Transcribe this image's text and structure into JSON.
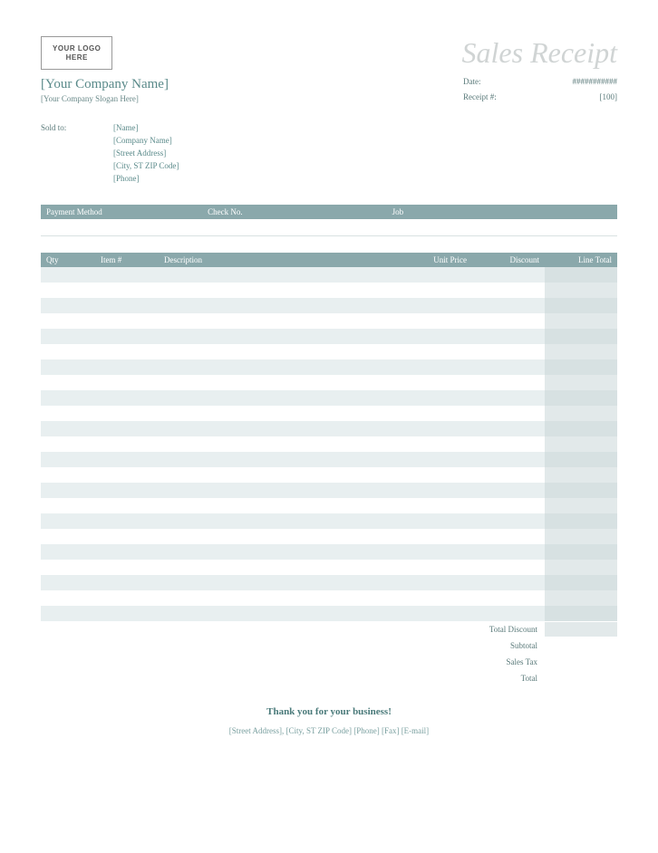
{
  "header": {
    "logo_text": "YOUR LOGO\nHERE",
    "title": "Sales Receipt"
  },
  "company": {
    "name": "[Your Company Name]",
    "slogan": "[Your Company Slogan Here]"
  },
  "meta": {
    "date_label": "Date:",
    "date_value": "###########",
    "receipt_label": "Receipt #:",
    "receipt_value": "[100]"
  },
  "sold_to": {
    "label": "Sold to:",
    "name": "[Name]",
    "company": "[Company Name]",
    "street": "[Street Address]",
    "city": "[City, ST  ZIP Code]",
    "phone": "[Phone]"
  },
  "payment_headers": {
    "method": "Payment Method",
    "check": "Check No.",
    "job": "Job"
  },
  "items_headers": {
    "qty": "Qty",
    "item": "Item #",
    "description": "Description",
    "unit_price": "Unit Price",
    "discount": "Discount",
    "line_total": "Line Total"
  },
  "items_row_count": 23,
  "totals": {
    "total_discount_label": "Total Discount",
    "subtotal_label": "Subtotal",
    "sales_tax_label": "Sales Tax",
    "total_label": "Total",
    "total_discount_value": "",
    "subtotal_value": "",
    "sales_tax_value": "",
    "total_value": ""
  },
  "thanks": "Thank you for your business!",
  "footer": "[Street Address], [City, ST  ZIP Code]  [Phone]  [Fax]  [E-mail]"
}
